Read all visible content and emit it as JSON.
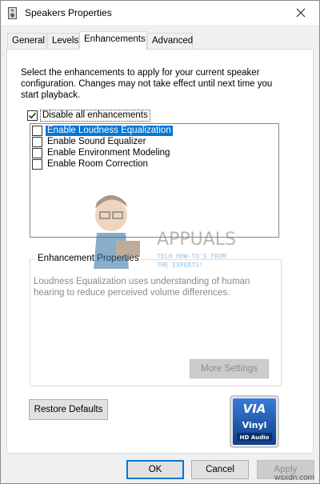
{
  "window": {
    "title": "Speakers Properties",
    "icon": "speaker-icon",
    "close_icon": "close-icon"
  },
  "tabs": [
    {
      "label": "General",
      "active": false
    },
    {
      "label": "Levels",
      "active": false
    },
    {
      "label": "Enhancements",
      "active": true
    },
    {
      "label": "Advanced",
      "active": false
    }
  ],
  "enhancements": {
    "description": "Select the enhancements to apply for your current speaker configuration. Changes may not take effect until next time you start playback.",
    "disable_all": {
      "label": "Disable all enhancements",
      "checked": true
    },
    "items": [
      {
        "label": "Enable Loudness Equalization",
        "checked": false,
        "selected": true
      },
      {
        "label": "Enable Sound Equalizer",
        "checked": false,
        "selected": false
      },
      {
        "label": "Enable Environment Modeling",
        "checked": false,
        "selected": false
      },
      {
        "label": "Enable Room Correction",
        "checked": false,
        "selected": false
      }
    ]
  },
  "properties": {
    "title": "Enhancement Properties",
    "description": "Loudness Equalization uses understanding of human hearing to reduce perceived volume differences.",
    "more_settings_label": "More Settings"
  },
  "restore_defaults_label": "Restore Defaults",
  "badge": {
    "brand": "VIA",
    "product": "Vinyl",
    "sub": "HD Audio"
  },
  "watermark": {
    "name": "APPUALS",
    "tagline_1": "TECH HOW-TO'S FROM",
    "tagline_2": "THE EXPERTS!"
  },
  "buttons": {
    "ok": "OK",
    "cancel": "Cancel",
    "apply": "Apply"
  },
  "footer": "wsxdn.com",
  "colors": {
    "selection": "#0078d7",
    "badge_blue": "#1f5fb4",
    "disabled_text": "#8c8c8c"
  }
}
